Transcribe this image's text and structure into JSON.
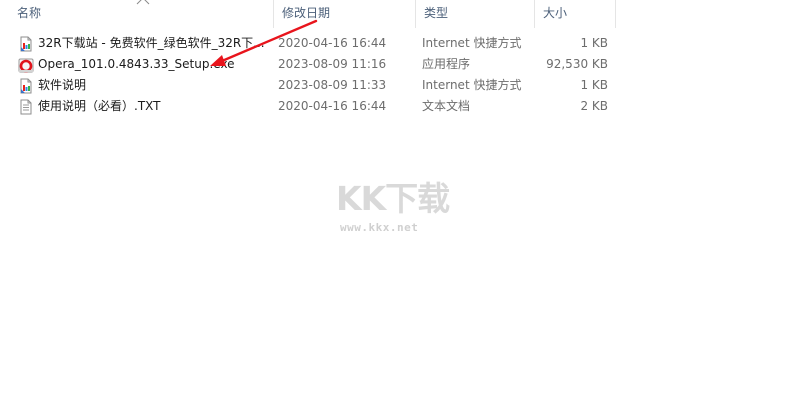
{
  "columns": {
    "name": "名称",
    "date": "修改日期",
    "type": "类型",
    "size": "大小"
  },
  "files": [
    {
      "icon": "internet-shortcut-icon",
      "name": "32R下载站 - 免费软件_绿色软件_32R下...",
      "date": "2020-04-16 16:44",
      "type": "Internet 快捷方式",
      "size": "1 KB"
    },
    {
      "icon": "opera-installer-icon",
      "name": "Opera_101.0.4843.33_Setup.exe",
      "date": "2023-08-09 11:16",
      "type": "应用程序",
      "size": "92,530 KB"
    },
    {
      "icon": "internet-shortcut-icon",
      "name": "软件说明",
      "date": "2023-08-09 11:33",
      "type": "Internet 快捷方式",
      "size": "1 KB"
    },
    {
      "icon": "text-document-icon",
      "name": "使用说明（必看）.TXT",
      "date": "2020-04-16 16:44",
      "type": "文本文档",
      "size": "2 KB"
    }
  ],
  "watermark": {
    "logo_text": "KK下载",
    "url": "www.kkx.net"
  },
  "colors": {
    "header_text": "#4c607a",
    "detail_text": "#6d6d6d",
    "arrow": "#e8141c"
  }
}
